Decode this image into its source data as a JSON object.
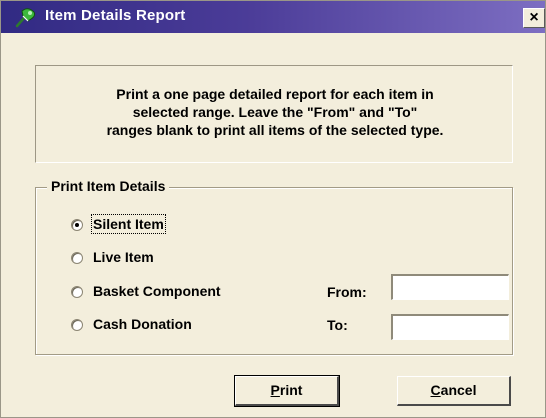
{
  "window": {
    "title": "Item Details Report",
    "close_label": "×"
  },
  "info": {
    "lines": [
      "Print a one page detailed report for each item in",
      "selected range.  Leave the \"From\" and \"To\"",
      "ranges blank to print all items of the selected type."
    ]
  },
  "group": {
    "legend": "Print Item Details",
    "options": [
      {
        "label": "Silent Item",
        "selected": true
      },
      {
        "label": "Live Item",
        "selected": false
      },
      {
        "label": "Basket Component",
        "selected": false
      },
      {
        "label": "Cash Donation",
        "selected": false
      }
    ],
    "from_label": "From:",
    "from_value": "",
    "to_label": "To:",
    "to_value": ""
  },
  "buttons": {
    "print_underlined": "P",
    "print_rest": "rint",
    "cancel_underlined": "C",
    "cancel_rest": "ancel"
  },
  "colors": {
    "titlebar_start": "#312a83",
    "titlebar_end": "#7d6ec2",
    "dialog_bg": "#f3eedc"
  },
  "icons": {
    "app": "pin-icon"
  }
}
